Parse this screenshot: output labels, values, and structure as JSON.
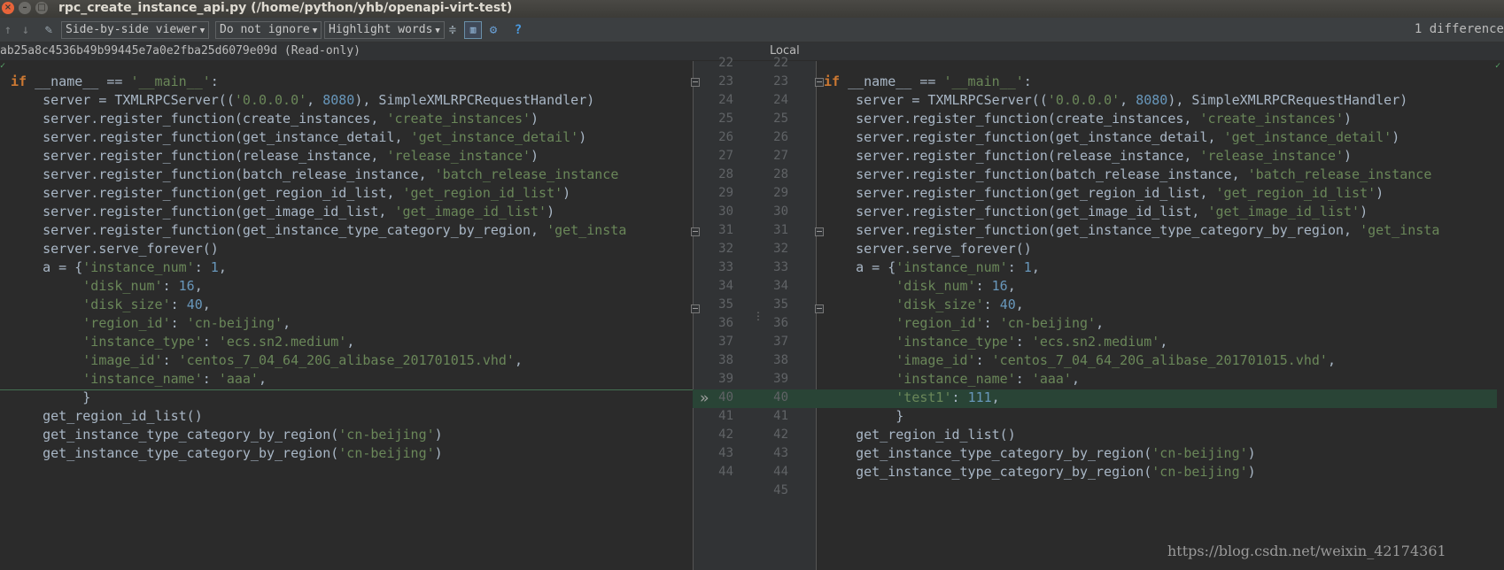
{
  "window": {
    "title": "rpc_create_instance_api.py (/home/python/yhb/openapi-virt-test)"
  },
  "toolbar": {
    "viewer": "Side-by-side viewer",
    "whitespace": "Do not ignore",
    "highlight": "Highlight words",
    "differences": "1 difference"
  },
  "headers": {
    "left": "ab25a8c4536b49b99445e7a0e2fba25d6079e09d (Read-only)",
    "right": "Local"
  },
  "left_lines": [
    [
      [
        "kw",
        "if"
      ],
      [
        "t",
        " __name__ == "
      ],
      [
        "str",
        "'__main__'"
      ],
      [
        "t",
        ":"
      ]
    ],
    [
      [
        "t",
        "    server = TXMLRPCServer(("
      ],
      [
        "str",
        "'0.0.0.0'"
      ],
      [
        "t",
        ", "
      ],
      [
        "num",
        "8080"
      ],
      [
        "t",
        "), SimpleXMLRPCRequestHandler)"
      ]
    ],
    [
      [
        "t",
        "    server.register_function(create_instances, "
      ],
      [
        "str",
        "'create_instances'"
      ],
      [
        "t",
        ")"
      ]
    ],
    [
      [
        "t",
        "    server.register_function(get_instance_detail, "
      ],
      [
        "str",
        "'get_instance_detail'"
      ],
      [
        "t",
        ")"
      ]
    ],
    [
      [
        "t",
        "    server.register_function(release_instance, "
      ],
      [
        "str",
        "'release_instance'"
      ],
      [
        "t",
        ")"
      ]
    ],
    [
      [
        "t",
        "    server.register_function(batch_release_instance, "
      ],
      [
        "str",
        "'batch_release_instance"
      ]
    ],
    [
      [
        "t",
        "    server.register_function(get_region_id_list, "
      ],
      [
        "str",
        "'get_region_id_list'"
      ],
      [
        "t",
        ")"
      ]
    ],
    [
      [
        "t",
        "    server.register_function(get_image_id_list, "
      ],
      [
        "str",
        "'get_image_id_list'"
      ],
      [
        "t",
        ")"
      ]
    ],
    [
      [
        "t",
        "    server.register_function(get_instance_type_category_by_region, "
      ],
      [
        "str",
        "'get_insta"
      ]
    ],
    [
      [
        "t",
        "    server.serve_forever()"
      ]
    ],
    [
      [
        "t",
        "    a = {"
      ],
      [
        "str",
        "'instance_num'"
      ],
      [
        "t",
        ": "
      ],
      [
        "num",
        "1"
      ],
      [
        "t",
        ","
      ]
    ],
    [
      [
        "t",
        "         "
      ],
      [
        "str",
        "'disk_num'"
      ],
      [
        "t",
        ": "
      ],
      [
        "num",
        "16"
      ],
      [
        "t",
        ","
      ]
    ],
    [
      [
        "t",
        "         "
      ],
      [
        "str",
        "'disk_size'"
      ],
      [
        "t",
        ": "
      ],
      [
        "num",
        "40"
      ],
      [
        "t",
        ","
      ]
    ],
    [
      [
        "t",
        "         "
      ],
      [
        "str",
        "'region_id'"
      ],
      [
        "t",
        ": "
      ],
      [
        "str",
        "'cn-beijing'"
      ],
      [
        "t",
        ","
      ]
    ],
    [
      [
        "t",
        "         "
      ],
      [
        "str",
        "'instance_type'"
      ],
      [
        "t",
        ": "
      ],
      [
        "str",
        "'ecs.sn2.medium'"
      ],
      [
        "t",
        ","
      ]
    ],
    [
      [
        "t",
        "         "
      ],
      [
        "str",
        "'image_id'"
      ],
      [
        "t",
        ": "
      ],
      [
        "str",
        "'centos_7_04_64_20G_alibase_201701015.vhd'"
      ],
      [
        "t",
        ","
      ]
    ],
    [
      [
        "t",
        "         "
      ],
      [
        "str",
        "'instance_name'"
      ],
      [
        "t",
        ": "
      ],
      [
        "str",
        "'aaa'"
      ],
      [
        "t",
        ","
      ]
    ],
    [
      [
        "t",
        "         }"
      ]
    ],
    [
      [
        "t",
        "    get_region_id_list()"
      ]
    ],
    [
      [
        "t",
        "    get_instance_type_category_by_region("
      ],
      [
        "str",
        "'cn-beijing'"
      ],
      [
        "t",
        ")"
      ]
    ],
    [
      [
        "t",
        "    get_instance_type_category_by_region("
      ],
      [
        "str",
        "'cn-beijing'"
      ],
      [
        "t",
        ")"
      ]
    ]
  ],
  "right_lines": [
    [
      [
        "kw",
        "if"
      ],
      [
        "t",
        " __name__ == "
      ],
      [
        "str",
        "'__main__'"
      ],
      [
        "t",
        ":"
      ]
    ],
    [
      [
        "t",
        "    server = TXMLRPCServer(("
      ],
      [
        "str",
        "'0.0.0.0'"
      ],
      [
        "t",
        ", "
      ],
      [
        "num",
        "8080"
      ],
      [
        "t",
        "), SimpleXMLRPCRequestHandler)"
      ]
    ],
    [
      [
        "t",
        "    server.register_function(create_instances, "
      ],
      [
        "str",
        "'create_instances'"
      ],
      [
        "t",
        ")"
      ]
    ],
    [
      [
        "t",
        "    server.register_function(get_instance_detail, "
      ],
      [
        "str",
        "'get_instance_detail'"
      ],
      [
        "t",
        ")"
      ]
    ],
    [
      [
        "t",
        "    server.register_function(release_instance, "
      ],
      [
        "str",
        "'release_instance'"
      ],
      [
        "t",
        ")"
      ]
    ],
    [
      [
        "t",
        "    server.register_function(batch_release_instance, "
      ],
      [
        "str",
        "'batch_release_instance"
      ]
    ],
    [
      [
        "t",
        "    server.register_function(get_region_id_list, "
      ],
      [
        "str",
        "'get_region_id_list'"
      ],
      [
        "t",
        ")"
      ]
    ],
    [
      [
        "t",
        "    server.register_function(get_image_id_list, "
      ],
      [
        "str",
        "'get_image_id_list'"
      ],
      [
        "t",
        ")"
      ]
    ],
    [
      [
        "t",
        "    server.register_function(get_instance_type_category_by_region, "
      ],
      [
        "str",
        "'get_insta"
      ]
    ],
    [
      [
        "t",
        "    server.serve_forever()"
      ]
    ],
    [
      [
        "t",
        "    a = {"
      ],
      [
        "str",
        "'instance_num'"
      ],
      [
        "t",
        ": "
      ],
      [
        "num",
        "1"
      ],
      [
        "t",
        ","
      ]
    ],
    [
      [
        "t",
        "         "
      ],
      [
        "str",
        "'disk_num'"
      ],
      [
        "t",
        ": "
      ],
      [
        "num",
        "16"
      ],
      [
        "t",
        ","
      ]
    ],
    [
      [
        "t",
        "         "
      ],
      [
        "str",
        "'disk_size'"
      ],
      [
        "t",
        ": "
      ],
      [
        "num",
        "40"
      ],
      [
        "t",
        ","
      ]
    ],
    [
      [
        "t",
        "         "
      ],
      [
        "str",
        "'region_id'"
      ],
      [
        "t",
        ": "
      ],
      [
        "str",
        "'cn-beijing'"
      ],
      [
        "t",
        ","
      ]
    ],
    [
      [
        "t",
        "         "
      ],
      [
        "str",
        "'instance_type'"
      ],
      [
        "t",
        ": "
      ],
      [
        "str",
        "'ecs.sn2.medium'"
      ],
      [
        "t",
        ","
      ]
    ],
    [
      [
        "t",
        "         "
      ],
      [
        "str",
        "'image_id'"
      ],
      [
        "t",
        ": "
      ],
      [
        "str",
        "'centos_7_04_64_20G_alibase_201701015.vhd'"
      ],
      [
        "t",
        ","
      ]
    ],
    [
      [
        "t",
        "         "
      ],
      [
        "str",
        "'instance_name'"
      ],
      [
        "t",
        ": "
      ],
      [
        "str",
        "'aaa'"
      ],
      [
        "t",
        ","
      ]
    ],
    [
      [
        "t",
        "         "
      ],
      [
        "str",
        "'test1'"
      ],
      [
        "t",
        ": "
      ],
      [
        "num",
        "111"
      ],
      [
        "t",
        ","
      ]
    ],
    [
      [
        "t",
        "         }"
      ]
    ],
    [
      [
        "t",
        "    get_region_id_list()"
      ]
    ],
    [
      [
        "t",
        "    get_instance_type_category_by_region("
      ],
      [
        "str",
        "'cn-beijing'"
      ],
      [
        "t",
        ")"
      ]
    ],
    [
      [
        "t",
        "    get_instance_type_category_by_region("
      ],
      [
        "str",
        "'cn-beijing'"
      ],
      [
        "t",
        ")"
      ]
    ]
  ],
  "line_numbers": {
    "left": [
      "22",
      "23",
      "24",
      "25",
      "26",
      "27",
      "28",
      "29",
      "30",
      "31",
      "32",
      "33",
      "34",
      "35",
      "36",
      "37",
      "38",
      "39",
      "40",
      "41",
      "42",
      "43",
      "44"
    ],
    "right": [
      "22",
      "23",
      "24",
      "25",
      "26",
      "27",
      "28",
      "29",
      "30",
      "31",
      "32",
      "33",
      "34",
      "35",
      "36",
      "37",
      "38",
      "39",
      "40",
      "41",
      "42",
      "43",
      "44",
      "45"
    ]
  },
  "watermark": "https://blog.csdn.net/weixin_42174361",
  "colors": {
    "keyword": "#cc7832",
    "string": "#6a8759",
    "number": "#6897bb",
    "inserted_line_bg": "#294436"
  }
}
